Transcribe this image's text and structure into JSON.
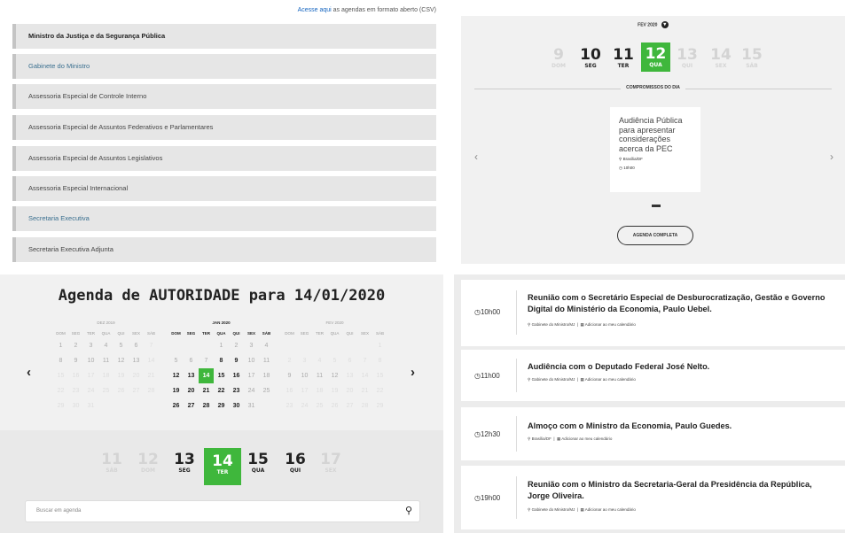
{
  "top_note": {
    "link": "Acesse aqui",
    "text": "as agendas em formato aberto (CSV)"
  },
  "orgs": [
    "Ministro da Justiça e da Segurança Pública",
    "Gabinete do Ministro",
    "Assessoria Especial de Controle Interno",
    "Assessoria Especial de Assuntos Federativos e Parlamentares",
    "Assessoria Especial de Assuntos Legislativos",
    "Assessoria Especial Internacional",
    "Secretaria Executiva",
    "Secretaria Executiva Adjunta"
  ],
  "slider": {
    "month": "FEV 2020",
    "days": [
      {
        "n": "9",
        "w": "DOM"
      },
      {
        "n": "10",
        "w": "SEG"
      },
      {
        "n": "11",
        "w": "TER"
      },
      {
        "n": "12",
        "w": "QUA"
      },
      {
        "n": "13",
        "w": "QUI"
      },
      {
        "n": "14",
        "w": "SEX"
      },
      {
        "n": "15",
        "w": "SÁB"
      }
    ],
    "section_title": "COMPROMISSOS DO DIA",
    "card": {
      "title": "Audiência Pública para apresentar considerações acerca da PEC",
      "location": "Brasília/DF",
      "time": "10h00"
    },
    "button": "AGENDA COMPLETA",
    "left_arrow": "‹",
    "right_arrow": "›"
  },
  "calendar": {
    "title": "Agenda de AUTORIDADE para 14/01/2020",
    "weekdays": [
      "DOM",
      "SEG",
      "TER",
      "QUA",
      "QUI",
      "SEX",
      "SÁB"
    ],
    "months": [
      {
        "name": "DEZ 2019",
        "weeks": [
          [
            "1",
            "2",
            "3",
            "4",
            "5",
            "6",
            "7"
          ],
          [
            "8",
            "9",
            "10",
            "11",
            "12",
            "13",
            "14"
          ],
          [
            "15",
            "16",
            "17",
            "18",
            "19",
            "20",
            "21"
          ],
          [
            "22",
            "23",
            "24",
            "25",
            "26",
            "27",
            "28"
          ],
          [
            "29",
            "30",
            "31",
            "",
            "",
            "",
            ""
          ]
        ]
      },
      {
        "name": "JAN 2020",
        "weeks": [
          [
            "",
            "",
            "",
            "1",
            "2",
            "3",
            "4"
          ],
          [
            "5",
            "6",
            "7",
            "8",
            "9",
            "10",
            "11"
          ],
          [
            "12",
            "13",
            "14",
            "15",
            "16",
            "17",
            "18"
          ],
          [
            "19",
            "20",
            "21",
            "22",
            "23",
            "24",
            "25"
          ],
          [
            "26",
            "27",
            "28",
            "29",
            "30",
            "31",
            ""
          ]
        ]
      },
      {
        "name": "FEV 2020",
        "weeks": [
          [
            "",
            "",
            "",
            "",
            "",
            "",
            "1"
          ],
          [
            "2",
            "3",
            "4",
            "5",
            "6",
            "7",
            "8"
          ],
          [
            "9",
            "10",
            "11",
            "12",
            "13",
            "14",
            "15"
          ],
          [
            "16",
            "17",
            "18",
            "19",
            "20",
            "21",
            "22"
          ],
          [
            "23",
            "24",
            "25",
            "26",
            "27",
            "28",
            "29"
          ]
        ]
      }
    ],
    "strip_days": [
      {
        "n": "11",
        "w": "SÁB"
      },
      {
        "n": "12",
        "w": "DOM"
      },
      {
        "n": "13",
        "w": "SEG"
      },
      {
        "n": "14",
        "w": "TER"
      },
      {
        "n": "15",
        "w": "QUA"
      },
      {
        "n": "16",
        "w": "QUI"
      },
      {
        "n": "17",
        "w": "SEX"
      }
    ],
    "search_placeholder": "Buscar em agenda",
    "prev": "‹",
    "next": "›"
  },
  "events": [
    {
      "time": "10h00",
      "title": "Reunião com o Secretário Especial de Desburocratização, Gestão e Governo Digital do Ministério da Economia, Paulo Uebel.",
      "location": "Gabinete do Ministro/MJ",
      "calendar": "Adicionar ao meu calendário"
    },
    {
      "time": "11h00",
      "title": "Audiência com o Deputado Federal José Nelto.",
      "location": "Gabinete do Ministro/MJ",
      "calendar": "Adicionar ao meu calendário"
    },
    {
      "time": "12h30",
      "title": "Almoço com o Ministro da Economia, Paulo Guedes.",
      "location": "Brasília/DF",
      "calendar": "Adicionar ao meu calendário"
    },
    {
      "time": "19h00",
      "title": "Reunião com o Ministro da Secretaria-Geral da Presidência da República, Jorge Oliveira.",
      "location": "Gabinete do Ministro/MJ",
      "calendar": "Adicionar ao meu calendário"
    }
  ],
  "icons": {
    "search": "search-icon",
    "pin": "pin-icon",
    "clock": "clock-icon",
    "calendar": "calendar-icon"
  },
  "colors": {
    "accent": "#3fb73c",
    "link": "#1565c0"
  }
}
